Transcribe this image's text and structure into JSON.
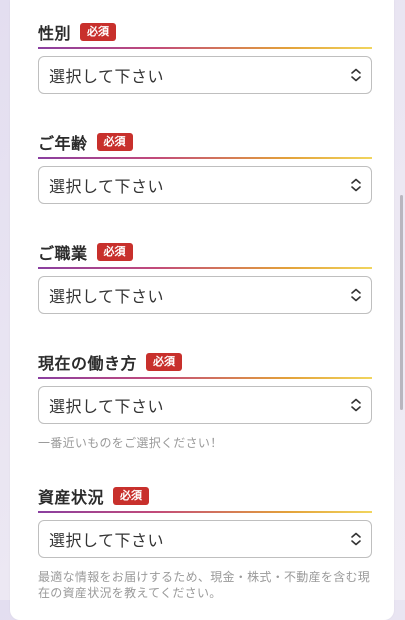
{
  "required_label": "必須",
  "placeholder": "選択して下さい",
  "fields": [
    {
      "label": "性別",
      "hint": ""
    },
    {
      "label": "ご年齢",
      "hint": ""
    },
    {
      "label": "ご職業",
      "hint": ""
    },
    {
      "label": "現在の働き方",
      "hint": "一番近いものをご選択ください！"
    },
    {
      "label": "資産状況",
      "hint": "最適な情報をお届けするため、現金・株式・不動産を含む現在の資産状況を教えてください。"
    }
  ],
  "colors": {
    "badge": "#c8302c",
    "underline_start": "#8a3fa0",
    "underline_end": "#f1d55e"
  }
}
